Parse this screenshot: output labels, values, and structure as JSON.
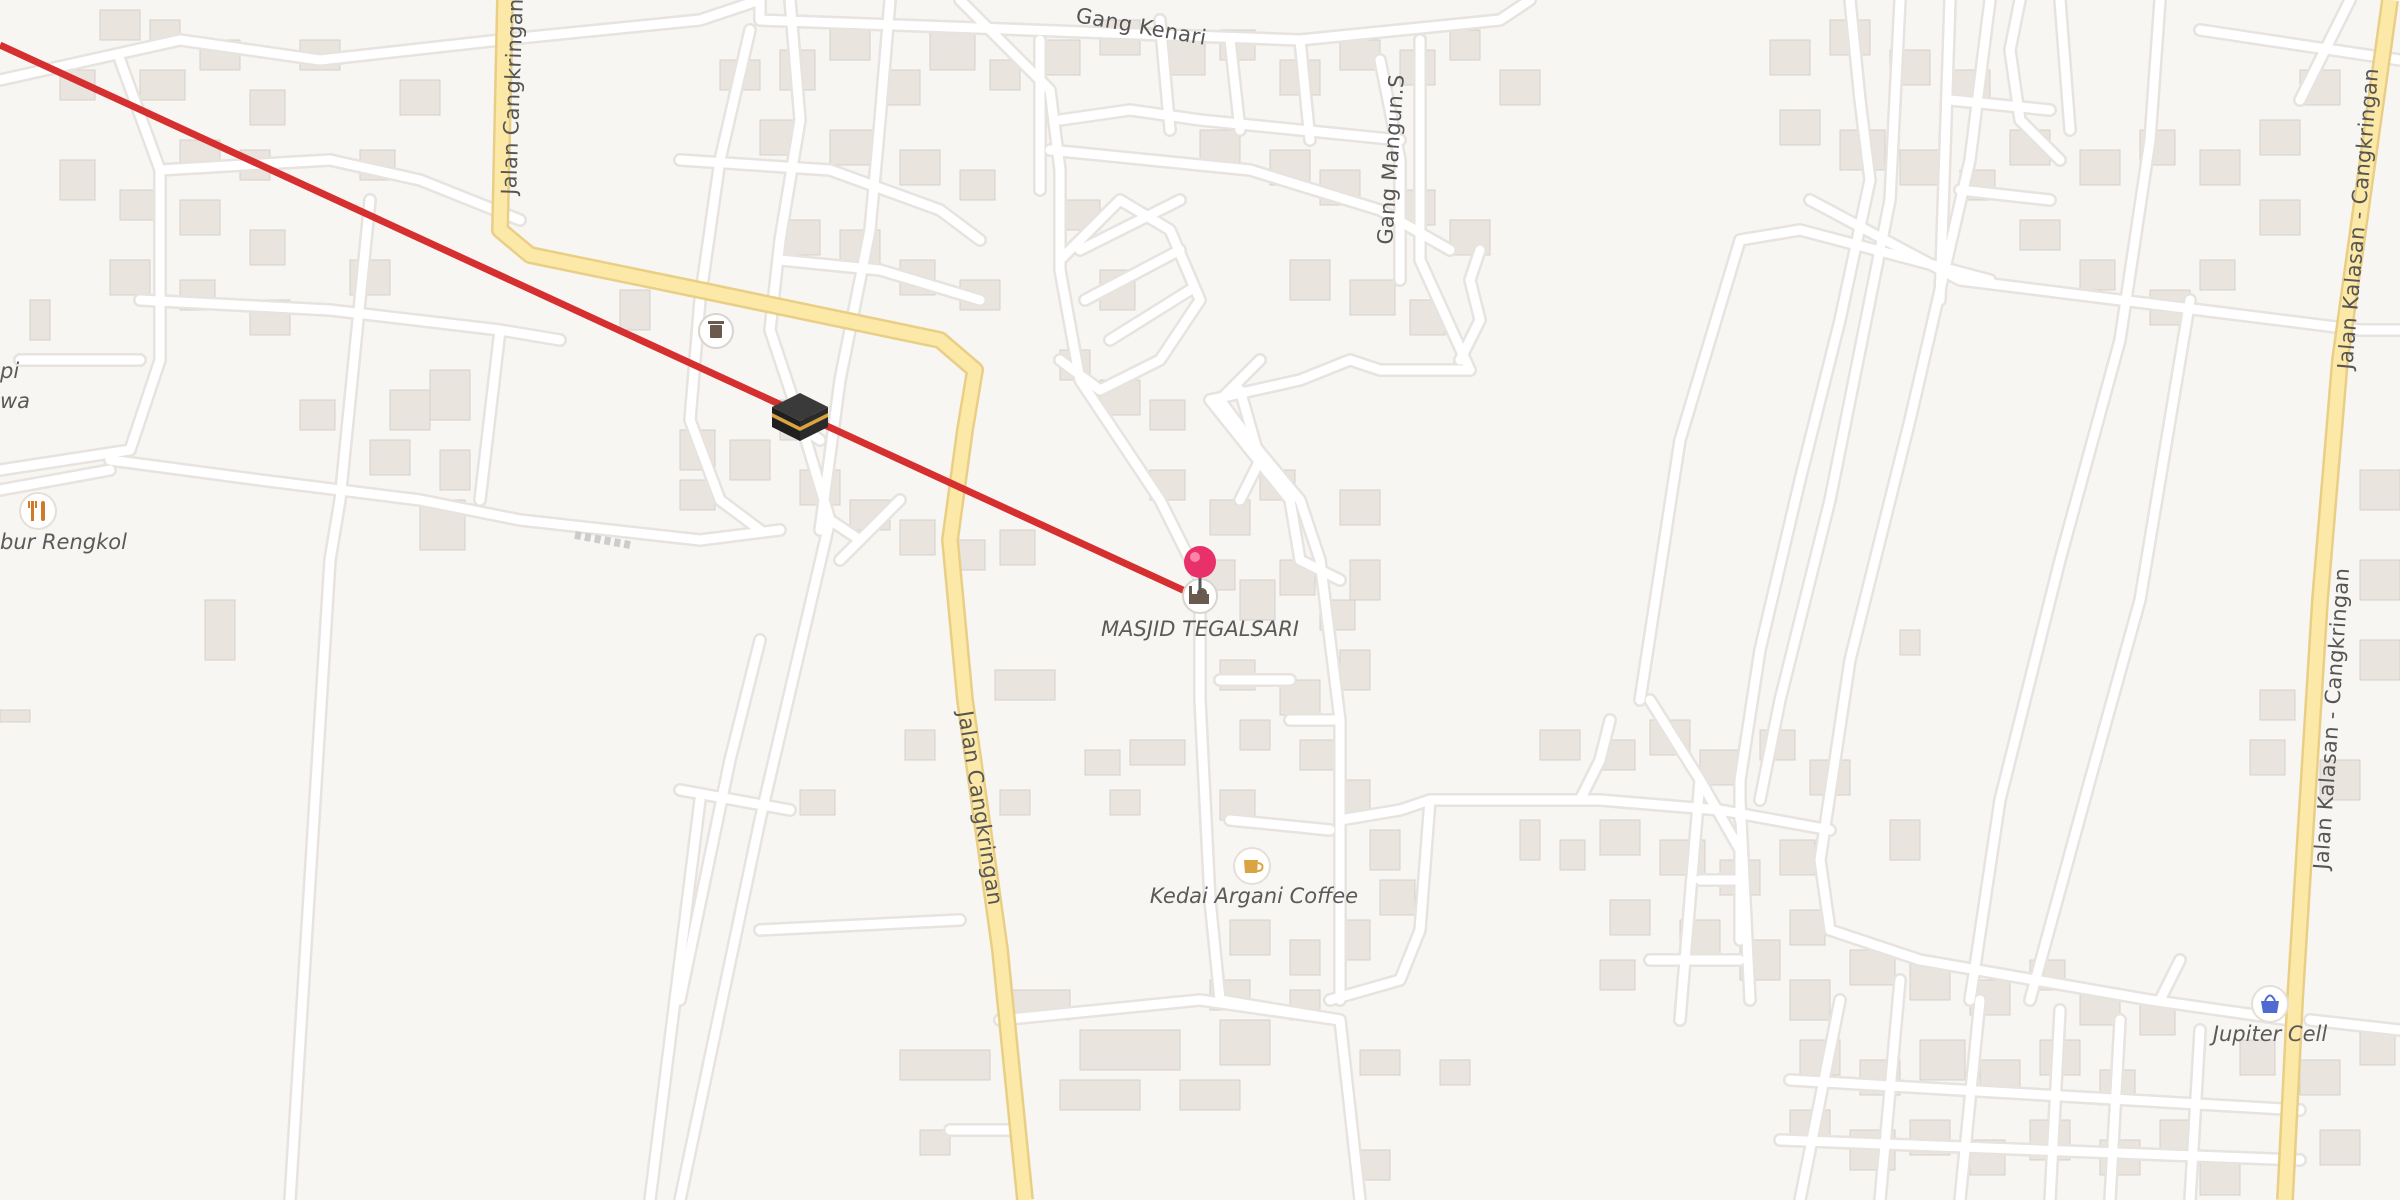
{
  "streets": {
    "gang_kenari": "Gang Kenari",
    "gang_mangun": "Gang Mangun.S",
    "jalan_cangkringan_top": "Jalan Cangkringan",
    "jalan_cangkringan_mid": "Jalan Cangkringan",
    "jalan_kalasan_top": "Jalan Kalasan - Cangkringan",
    "jalan_kalasan_bottom": "Jalan Kalasan - Cangkringan"
  },
  "pois": {
    "masjid": "MASJID TEGALSARI",
    "coffee": "Kedai Argani Coffee",
    "jupiter": "Jupiter Cell",
    "rengkol": "bur Rengkol",
    "left_line1": "pi",
    "left_line2": "wa"
  },
  "icons": {
    "selected_marker": "map-pin-icon",
    "mosque": "mosque-icon",
    "kaaba": "kaaba-icon",
    "trash": "waste-basket-icon",
    "restaurant": "fork-knife-icon",
    "coffee": "coffee-cup-icon",
    "shop": "shopping-basket-icon"
  },
  "colors": {
    "background": "#f8f6f3",
    "road": "#ffffff",
    "main_road": "#fde9a7",
    "main_road_casing": "#e9cf86",
    "qibla_line": "#d62f2f",
    "pin": "#e8316b",
    "building": "#e9e4de"
  }
}
